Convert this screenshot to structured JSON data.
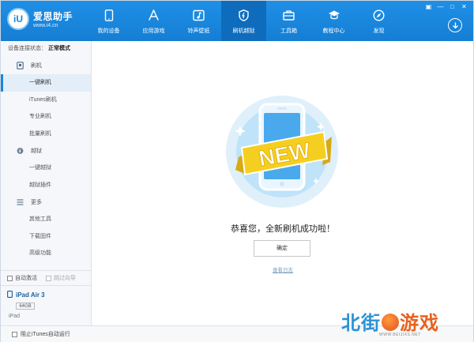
{
  "header": {
    "logo_badge": "iU",
    "logo_name": "爱思助手",
    "logo_url": "www.i4.cn",
    "nav": [
      {
        "label": "我的设备",
        "icon": "phone-icon",
        "active": false
      },
      {
        "label": "应用游戏",
        "icon": "app-store-icon",
        "active": false
      },
      {
        "label": "铃声壁纸",
        "icon": "music-wallpaper-icon",
        "active": false
      },
      {
        "label": "刷机越狱",
        "icon": "flash-jailbreak-icon",
        "active": true
      },
      {
        "label": "工具箱",
        "icon": "toolbox-icon",
        "active": false
      },
      {
        "label": "教程中心",
        "icon": "graduation-cap-icon",
        "active": false
      },
      {
        "label": "发现",
        "icon": "compass-icon",
        "active": false
      }
    ],
    "window_controls": [
      "▣",
      "—",
      "□",
      "✕"
    ],
    "download_icon": "download-icon"
  },
  "sidebar": {
    "status_label": "设备连接状态：",
    "status_value": "正常模式",
    "groups": [
      {
        "label": "刷机",
        "icon": "flash-icon",
        "items": [
          "一键刷机",
          "iTunes刷机",
          "专业刷机",
          "批量刷机"
        ]
      },
      {
        "label": "越狱",
        "icon": "jailbreak-icon",
        "items": [
          "一键越狱",
          "越狱插件"
        ]
      },
      {
        "label": "更多",
        "icon": "more-icon",
        "items": [
          "其他工具",
          "下载固件",
          "高级功能"
        ]
      }
    ],
    "active_item": "一键刷机",
    "auto_activate": "自动激活",
    "skip_guide": "跳过向导",
    "device": {
      "name": "iPad Air 3",
      "capacity": "64GB",
      "type": "iPad"
    }
  },
  "main": {
    "banner_text": "NEW",
    "success_message": "恭喜您，全新刷机成功啦！",
    "ok_button": "确定",
    "view_log": "查看日志"
  },
  "footer": {
    "block_itunes": "阻止iTunes自动运行"
  },
  "watermark": {
    "part1": "北街",
    "part2": "游戏",
    "url": "WWW.BEIJIXS.NET"
  },
  "colors": {
    "header_blue": "#1a86dc",
    "active_nav": "#0f6cbd",
    "sidebar_bg": "#f5f7fa",
    "ribbon_yellow": "#f5cf1f"
  }
}
